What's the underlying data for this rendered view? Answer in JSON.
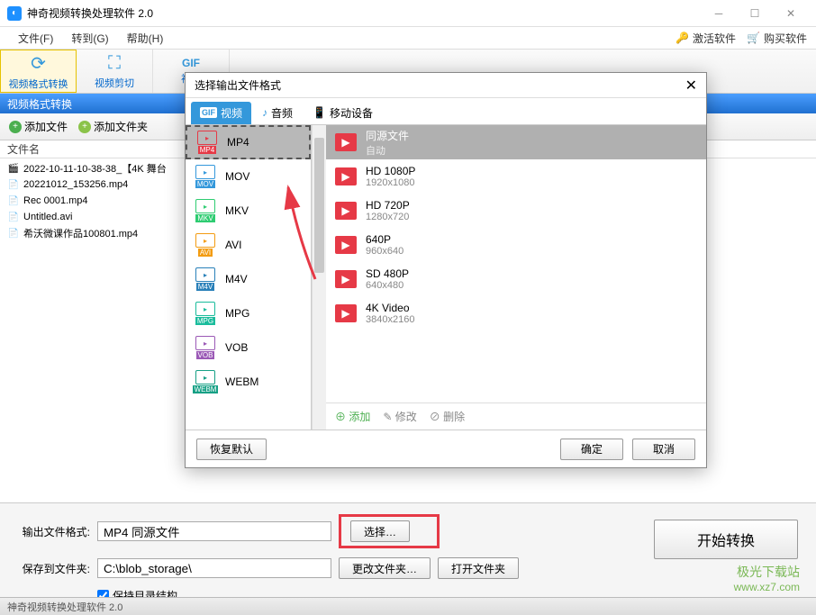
{
  "app": {
    "title": "神奇视频转换处理软件 2.0",
    "status": "神奇视频转换处理软件 2.0"
  },
  "menu": {
    "file": "文件(F)",
    "goto": "转到(G)",
    "help": "帮助(H)",
    "activate": "激活软件",
    "buy": "购买软件"
  },
  "toolbar": {
    "format": "视频格式转换",
    "crop": "视频剪切",
    "gif": "视频"
  },
  "section": {
    "title": "视频格式转换"
  },
  "actions": {
    "addfile": "添加文件",
    "addfolder": "添加文件夹"
  },
  "filelist": {
    "header": "文件名",
    "files": [
      "2022-10-11-10-38-38_【4K 舞台",
      "20221012_153256.mp4",
      "Rec 0001.mp4",
      "Untitled.avi",
      "希沃微课作品100801.mp4"
    ]
  },
  "bottom": {
    "outfmt_label": "输出文件格式:",
    "outfmt_value": "MP4 同源文件",
    "select": "选择…",
    "saveto_label": "保存到文件夹:",
    "saveto_value": "C:\\blob_storage\\",
    "change": "更改文件夹…",
    "open": "打开文件夹",
    "keep": "保持目录结构",
    "start": "开始转换"
  },
  "dialog": {
    "title": "选择输出文件格式",
    "tabs": {
      "video": "视频",
      "audio": "音频",
      "device": "移动设备"
    },
    "formats": [
      "MP4",
      "MOV",
      "MKV",
      "AVI",
      "M4V",
      "MPG",
      "VOB",
      "WEBM"
    ],
    "fmt_colors": [
      "#e63946",
      "#3498db",
      "#2ecc71",
      "#f39c12",
      "#2980b9",
      "#1abc9c",
      "#9b59b6",
      "#16a085"
    ],
    "presets": [
      {
        "name": "同源文件",
        "sub": "自动"
      },
      {
        "name": "HD 1080P",
        "sub": "1920x1080"
      },
      {
        "name": "HD 720P",
        "sub": "1280x720"
      },
      {
        "name": "640P",
        "sub": "960x640"
      },
      {
        "name": "SD 480P",
        "sub": "640x480"
      },
      {
        "name": "4K Video",
        "sub": "3840x2160"
      }
    ],
    "preset_actions": {
      "add": "添加",
      "edit": "修改",
      "del": "删除"
    },
    "footer": {
      "reset": "恢复默认",
      "ok": "确定",
      "cancel": "取消"
    }
  },
  "watermark": {
    "l1": "极光下载站",
    "l2": "www.xz7.com"
  }
}
